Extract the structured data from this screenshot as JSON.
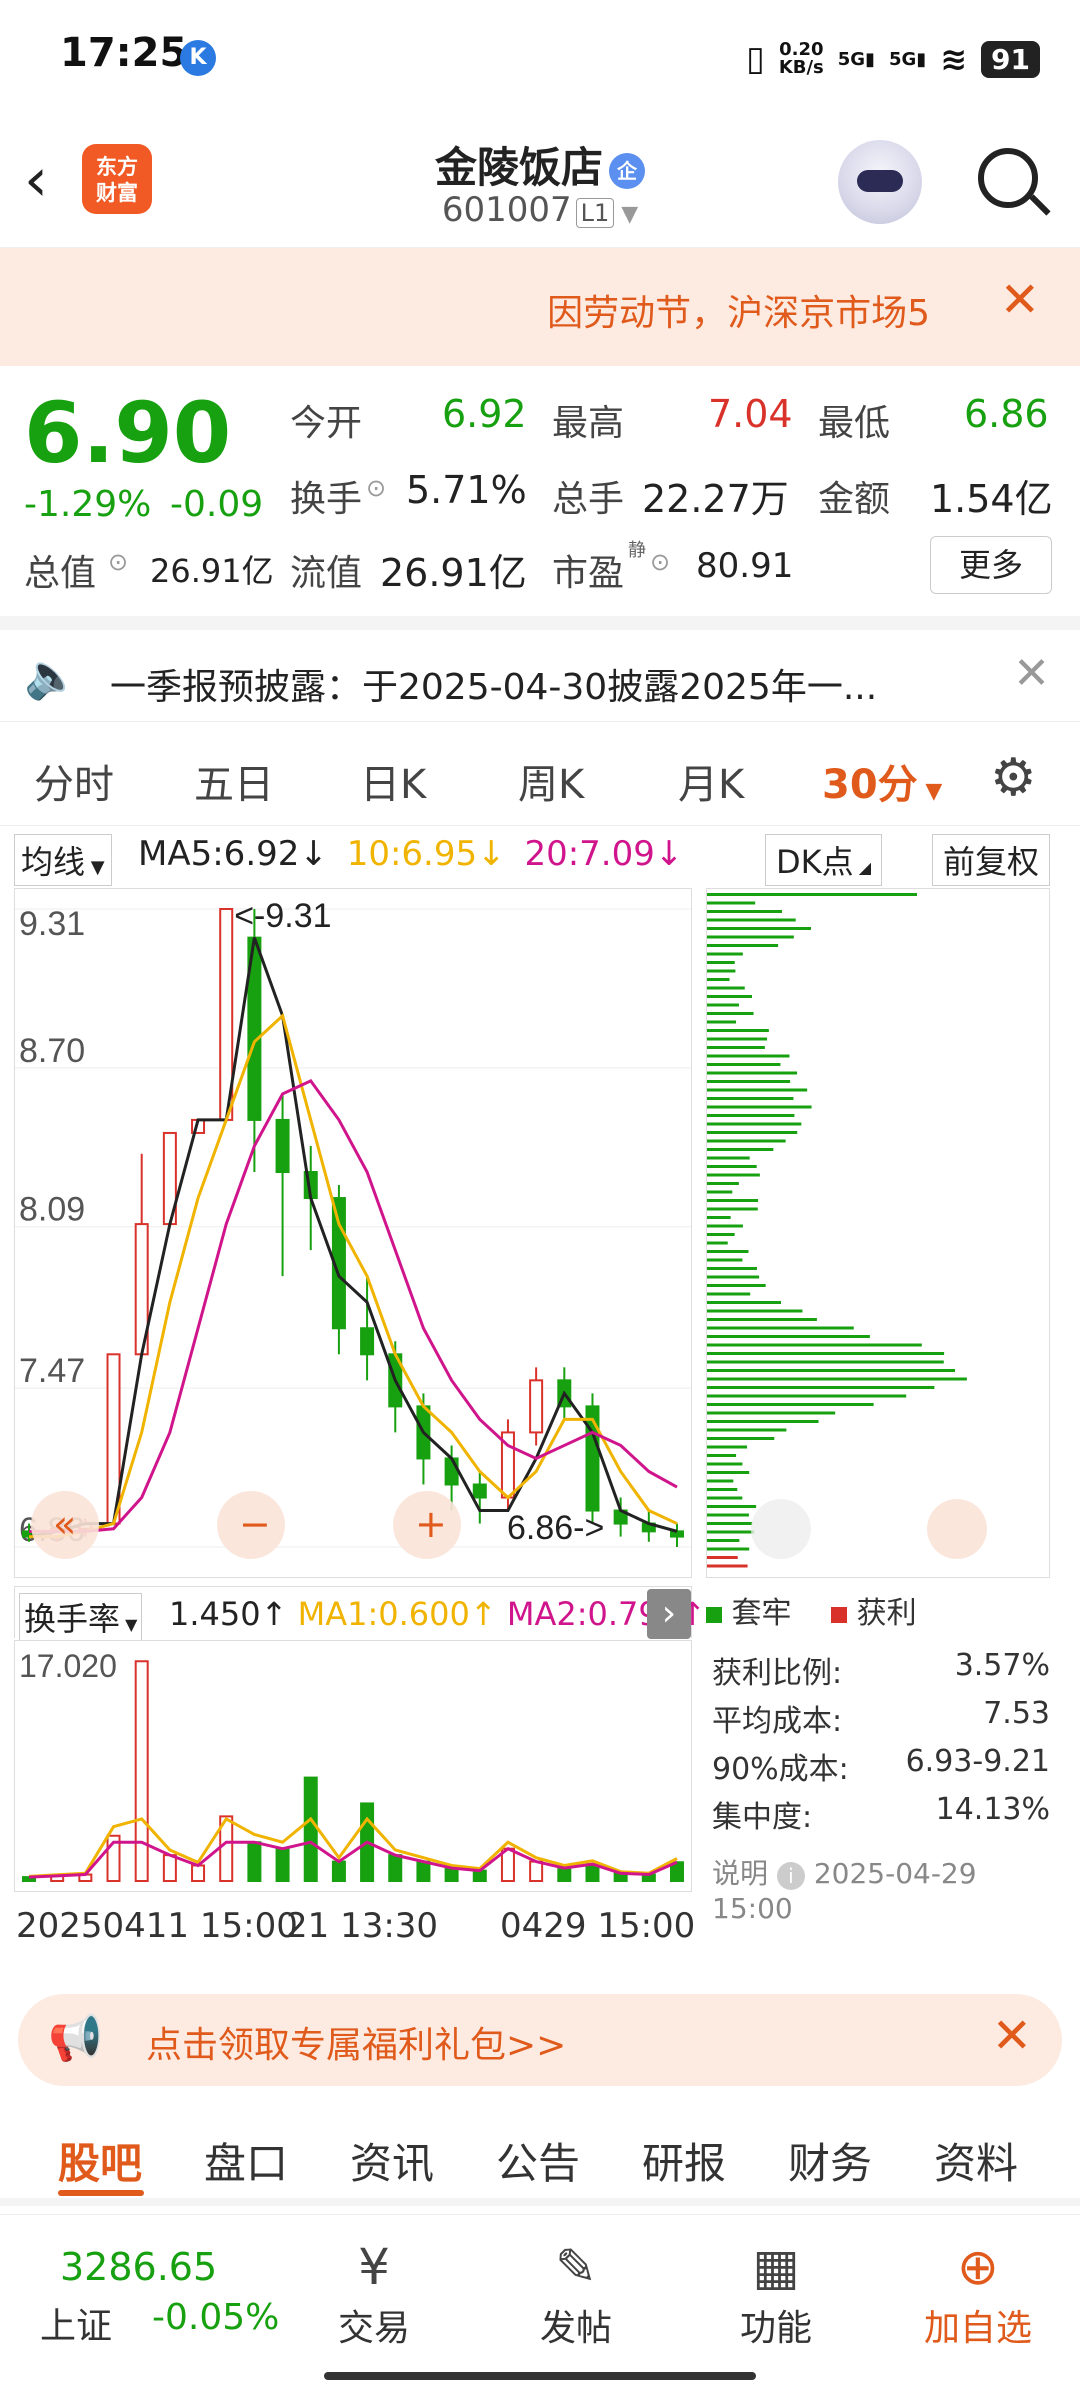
{
  "status": {
    "time": "17:25",
    "net_speed_value": "0.20",
    "net_speed_unit": "KB/s",
    "sig1": "5G",
    "sig2": "5G",
    "battery": "91"
  },
  "header": {
    "logo": "东方财富",
    "title": "金陵饭店",
    "qi_badge": "企",
    "code": "601007",
    "tier": "L1"
  },
  "notice": {
    "text": "因劳动节，沪深京市场5"
  },
  "quote": {
    "price": "6.90",
    "change_pct": "-1.29%",
    "change_amt": "-0.09",
    "open_label": "今开",
    "open": "6.92",
    "high_label": "最高",
    "high": "7.04",
    "low_label": "最低",
    "low": "6.86",
    "turnover_label": "换手",
    "turnover": "5.71%",
    "volume_label": "总手",
    "volume": "22.27万",
    "amount_label": "金额",
    "amount": "1.54亿",
    "mktcap_label": "总值",
    "mktcap": "26.91亿",
    "float_label": "流值",
    "float": "26.91亿",
    "pe_label": "市盈",
    "pe_sup": "静",
    "pe": "80.91",
    "more": "更多"
  },
  "disclosure": {
    "text": "一季报预披露：于2025-04-30披露2025年一..."
  },
  "tabs": [
    "分时",
    "五日",
    "日K",
    "周K",
    "月K",
    "30分"
  ],
  "ma": {
    "junxian": "均线",
    "ma5": "MA5:6.92",
    "ma10": "10:6.95",
    "ma20": "20:7.09",
    "dk": "DK点",
    "fq": "前复权"
  },
  "chart_data": {
    "type": "line",
    "title": "",
    "y_ticks": [
      "9.31",
      "8.70",
      "8.09",
      "7.47",
      "6.86"
    ],
    "ylim": [
      6.86,
      9.31
    ],
    "high_marker": "<-9.31",
    "low_marker": "6.86->",
    "x_labels": [
      "20250411 15:00",
      "21 13:30",
      "0429 15:00"
    ],
    "series": [
      {
        "name": "MA5",
        "color": "#222222",
        "values": [
          6.9,
          6.92,
          6.95,
          6.95,
          7.6,
          8.1,
          8.5,
          8.5,
          9.2,
          8.9,
          8.2,
          7.9,
          7.8,
          7.5,
          7.3,
          7.2,
          7.0,
          7.0,
          7.2,
          7.45,
          7.3,
          7.0,
          6.95,
          6.92
        ]
      },
      {
        "name": "10",
        "color": "#f0b400",
        "values": [
          6.9,
          6.9,
          6.92,
          6.95,
          7.3,
          7.8,
          8.2,
          8.5,
          8.8,
          8.9,
          8.5,
          8.1,
          7.9,
          7.6,
          7.4,
          7.3,
          7.15,
          7.05,
          7.15,
          7.35,
          7.35,
          7.15,
          7.0,
          6.95
        ]
      },
      {
        "name": "20",
        "color": "#d0158c",
        "values": [
          6.92,
          6.92,
          6.92,
          6.93,
          7.05,
          7.3,
          7.7,
          8.1,
          8.4,
          8.6,
          8.65,
          8.5,
          8.3,
          8.0,
          7.7,
          7.5,
          7.35,
          7.25,
          7.2,
          7.25,
          7.3,
          7.25,
          7.15,
          7.09
        ]
      }
    ],
    "candles": [
      [
        6.92,
        6.9,
        6.95,
        6.88
      ],
      [
        6.9,
        6.93,
        6.95,
        6.88
      ],
      [
        6.93,
        6.95,
        6.97,
        6.9
      ],
      [
        6.95,
        7.6,
        7.6,
        6.95
      ],
      [
        7.6,
        8.1,
        8.37,
        7.6
      ],
      [
        8.1,
        8.45,
        8.45,
        8.1
      ],
      [
        8.45,
        8.5,
        8.5,
        8.45
      ],
      [
        8.5,
        9.31,
        9.31,
        8.5
      ],
      [
        9.2,
        8.5,
        9.31,
        8.3
      ],
      [
        8.5,
        8.3,
        8.6,
        7.9
      ],
      [
        8.3,
        8.2,
        8.4,
        8.0
      ],
      [
        8.2,
        7.7,
        8.25,
        7.6
      ],
      [
        7.7,
        7.6,
        7.9,
        7.5
      ],
      [
        7.6,
        7.4,
        7.65,
        7.3
      ],
      [
        7.4,
        7.2,
        7.45,
        7.1
      ],
      [
        7.2,
        7.1,
        7.25,
        7.0
      ],
      [
        7.1,
        7.05,
        7.15,
        6.95
      ],
      [
        7.05,
        7.3,
        7.35,
        7.0
      ],
      [
        7.3,
        7.5,
        7.55,
        7.25
      ],
      [
        7.5,
        7.4,
        7.55,
        7.35
      ],
      [
        7.4,
        7.0,
        7.45,
        6.95
      ],
      [
        7.0,
        6.95,
        7.05,
        6.9
      ],
      [
        6.95,
        6.92,
        7.0,
        6.88
      ],
      [
        6.92,
        6.9,
        6.95,
        6.86
      ]
    ],
    "volume_label": "换手率",
    "volume_value": "1.450",
    "vol_ma1": "MA1:0.600",
    "vol_ma2": "MA2:0.790",
    "volume_max": "17.020",
    "volume": [
      0.3,
      0.4,
      0.5,
      3.5,
      17.0,
      2.0,
      1.2,
      5.0,
      3.0,
      2.5,
      8.0,
      1.5,
      6.0,
      2.0,
      1.5,
      1.0,
      0.8,
      2.5,
      1.5,
      1.0,
      1.3,
      0.6,
      0.5,
      1.45
    ]
  },
  "chip": {
    "legend_trap": "套牢",
    "legend_profit": "获利",
    "profit_ratio_label": "获利比例:",
    "profit_ratio": "3.57%",
    "avg_cost_label": "平均成本:",
    "avg_cost": "7.53",
    "cost90_label": "90%成本:",
    "cost90": "6.93-9.21",
    "concentration_label": "集中度:",
    "concentration": "14.13%",
    "note_label": "说明",
    "note_time": "2025-04-29 15:00"
  },
  "promo": {
    "text": "点击领取专属福利礼包>>"
  },
  "subtabs": [
    "股吧",
    "盘口",
    "资讯",
    "公告",
    "研报",
    "财务",
    "资料"
  ],
  "bottom": {
    "index_value": "3286.65",
    "index_name": "上证",
    "index_change": "-0.05%",
    "items": [
      "交易",
      "发帖",
      "功能",
      "加自选"
    ]
  }
}
